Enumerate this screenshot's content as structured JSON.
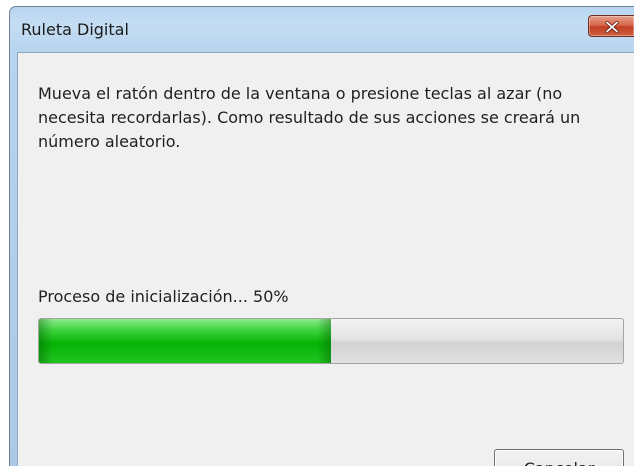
{
  "window": {
    "title": "Ruleta Digital"
  },
  "dialog": {
    "message": "Mueva el ratón dentro de la ventana o presione teclas al azar (no necesita recordarlas). Como resultado de sus acciones se creará un número aleatorio.",
    "progress_label": "Proceso de inicialización... 50%",
    "progress_fraction": 0.5,
    "cancel_label": "Cancelar"
  },
  "icons": {
    "close": "close-icon"
  },
  "colors": {
    "progress_fill": "#06b306",
    "close_button": "#c23f22"
  }
}
